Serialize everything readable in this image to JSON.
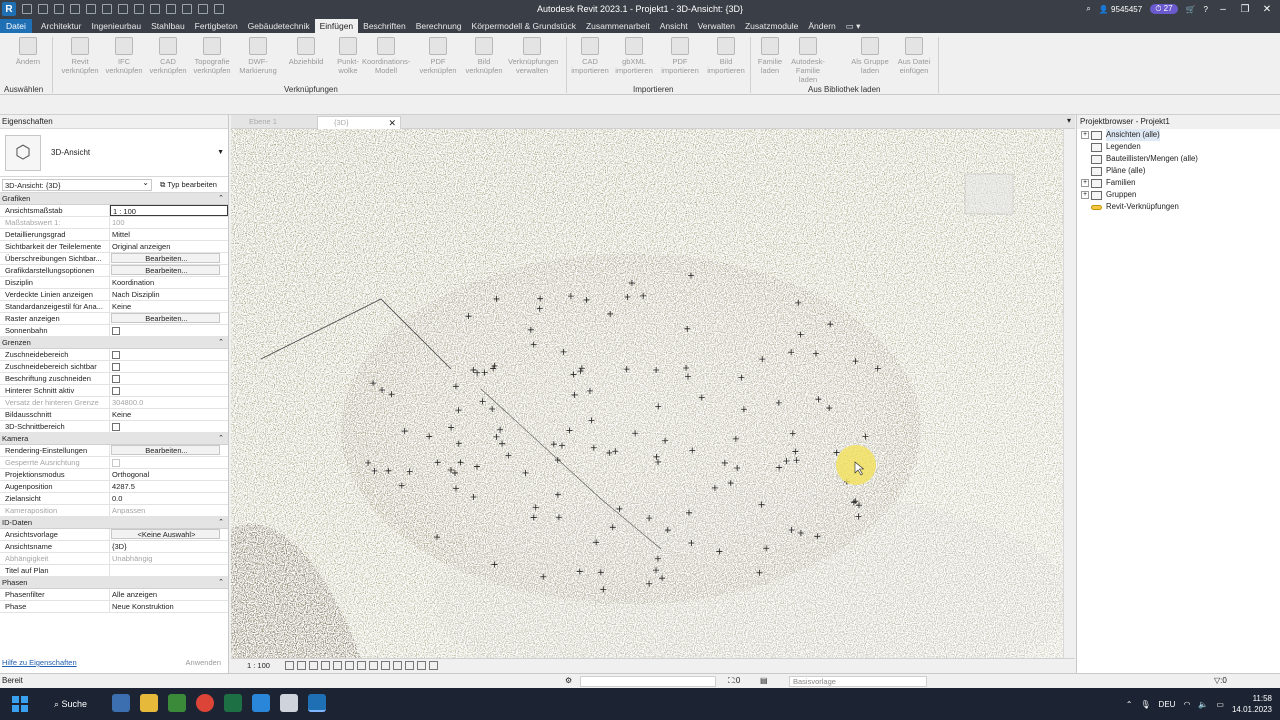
{
  "window": {
    "title": "Autodesk Revit 2023.1 - Projekt1 - 3D-Ansicht: {3D}",
    "user": "9545457",
    "notifications": "27"
  },
  "menu": {
    "tabs": [
      "Datei",
      "Architektur",
      "Ingenieurbau",
      "Stahlbau",
      "Fertigbeton",
      "Gebäudetechnik",
      "Einfügen",
      "Beschriften",
      "Berechnung",
      "Körpermodell & Grundstück",
      "Zusammenarbeit",
      "Ansicht",
      "Verwalten",
      "Zusatzmodule",
      "Ändern"
    ],
    "active": "Einfügen"
  },
  "ribbon": {
    "buttons": [
      {
        "l1": "Ändern",
        "l2": ""
      },
      {
        "l1": "Revit",
        "l2": "verknüpfen"
      },
      {
        "l1": "IFC",
        "l2": "verknüpfen"
      },
      {
        "l1": "CAD",
        "l2": "verknüpfen"
      },
      {
        "l1": "Topografie",
        "l2": "verknüpfen"
      },
      {
        "l1": "DWF-",
        "l2": "Markierung"
      },
      {
        "l1": "Abziehbild",
        "l2": ""
      },
      {
        "l1": "Punkt-",
        "l2": "wolke"
      },
      {
        "l1": "Koordinations-",
        "l2": "Modell"
      },
      {
        "l1": "PDF",
        "l2": "verknüpfen"
      },
      {
        "l1": "Bild",
        "l2": "verknüpfen"
      },
      {
        "l1": "Verknüpfungen",
        "l2": "verwalten"
      },
      {
        "l1": "CAD",
        "l2": "importieren"
      },
      {
        "l1": "gbXML",
        "l2": "importieren"
      },
      {
        "l1": "PDF",
        "l2": "importieren"
      },
      {
        "l1": "Bild",
        "l2": "importieren"
      },
      {
        "l1": "Familie",
        "l2": "laden"
      },
      {
        "l1": "Autodesk-Familie",
        "l2": "laden"
      },
      {
        "l1": "Als Gruppe",
        "l2": "laden"
      },
      {
        "l1": "Aus Datei",
        "l2": "einfügen"
      }
    ],
    "panels": [
      "Auswählen",
      "Verknüpfungen",
      "Importieren",
      "Aus Bibliothek laden"
    ]
  },
  "properties": {
    "title": "Eigenschaften",
    "type_name": "3D-Ansicht",
    "selector": "3D-Ansicht: {3D}",
    "edit_type": "Typ bearbeiten",
    "sections": [
      {
        "title": "Grafiken",
        "rows": [
          {
            "k": "Ansichtsmaßstab",
            "v": "1 : 100",
            "t": "input"
          },
          {
            "k": "Maßstabswert 1:",
            "v": "100",
            "t": "dim"
          },
          {
            "k": "Detaillierungsgrad",
            "v": "Mittel",
            "t": "text"
          },
          {
            "k": "Sichtbarkeit der Teilelemente",
            "v": "Original anzeigen",
            "t": "text"
          },
          {
            "k": "Überschreibungen Sichtbar...",
            "v": "Bearbeiten...",
            "t": "btn"
          },
          {
            "k": "Grafikdarstellungsoptionen",
            "v": "Bearbeiten...",
            "t": "btn"
          },
          {
            "k": "Disziplin",
            "v": "Koordination",
            "t": "text"
          },
          {
            "k": "Verdeckte Linien anzeigen",
            "v": "Nach Disziplin",
            "t": "text"
          },
          {
            "k": "Standardanzeigestil für Ana...",
            "v": "Keine",
            "t": "text"
          },
          {
            "k": "Raster anzeigen",
            "v": "Bearbeiten...",
            "t": "btn"
          },
          {
            "k": "Sonnenbahn",
            "v": "",
            "t": "chk"
          }
        ]
      },
      {
        "title": "Grenzen",
        "rows": [
          {
            "k": "Zuschneidebereich",
            "v": "",
            "t": "chk"
          },
          {
            "k": "Zuschneidebereich sichtbar",
            "v": "",
            "t": "chk"
          },
          {
            "k": "Beschriftung zuschneiden",
            "v": "",
            "t": "chk"
          },
          {
            "k": "Hinterer Schnitt aktiv",
            "v": "",
            "t": "chk"
          },
          {
            "k": "Versatz der hinteren Grenze",
            "v": "304800.0",
            "t": "dim"
          },
          {
            "k": "Bildausschnitt",
            "v": "Keine",
            "t": "text"
          },
          {
            "k": "3D-Schnittbereich",
            "v": "",
            "t": "chk"
          }
        ]
      },
      {
        "title": "Kamera",
        "rows": [
          {
            "k": "Rendering-Einstellungen",
            "v": "Bearbeiten...",
            "t": "btn"
          },
          {
            "k": "Gesperrte Ausrichtung",
            "v": "",
            "t": "dimchk"
          },
          {
            "k": "Projektionsmodus",
            "v": "Orthogonal",
            "t": "text"
          },
          {
            "k": "Augenposition",
            "v": "4287.5",
            "t": "text"
          },
          {
            "k": "Zielansicht",
            "v": "0.0",
            "t": "text"
          },
          {
            "k": "Kameraposition",
            "v": "Anpassen",
            "t": "dim"
          }
        ]
      },
      {
        "title": "ID-Daten",
        "rows": [
          {
            "k": "Ansichtsvorlage",
            "v": "<Keine Auswahl>",
            "t": "btn"
          },
          {
            "k": "Ansichtsname",
            "v": "{3D}",
            "t": "text"
          },
          {
            "k": "Abhängigkeit",
            "v": "Unabhängig",
            "t": "dim"
          },
          {
            "k": "Titel auf Plan",
            "v": "",
            "t": "text"
          }
        ]
      },
      {
        "title": "Phasen",
        "rows": [
          {
            "k": "Phasenfilter",
            "v": "Alle anzeigen",
            "t": "text"
          },
          {
            "k": "Phase",
            "v": "Neue Konstruktion",
            "t": "text"
          }
        ]
      }
    ],
    "help": "Hilfe zu Eigenschaften",
    "apply": "Anwenden"
  },
  "view": {
    "tabs": [
      {
        "label": "Ebene 1",
        "active": false
      },
      {
        "label": "{3D}",
        "active": true
      }
    ],
    "scale": "1 : 100"
  },
  "browser": {
    "title": "Projektbrowser - Projekt1",
    "items": [
      {
        "label": "Ansichten (alle)",
        "exp": "+",
        "sel": true,
        "link": false
      },
      {
        "label": "Legenden",
        "exp": "",
        "sel": false,
        "link": false
      },
      {
        "label": "Bauteillisten/Mengen (alle)",
        "exp": "",
        "sel": false,
        "link": false
      },
      {
        "label": "Pläne (alle)",
        "exp": "",
        "sel": false,
        "link": false
      },
      {
        "label": "Familien",
        "exp": "+",
        "sel": false,
        "link": false
      },
      {
        "label": "Gruppen",
        "exp": "+",
        "sel": false,
        "link": false
      },
      {
        "label": "Revit-Verknüpfungen",
        "exp": "",
        "sel": false,
        "link": true
      }
    ]
  },
  "status": {
    "ready": "Bereit",
    "selection_count": ":0",
    "template": "Basisvorlage",
    "filter": ":0"
  },
  "taskbar": {
    "search": "Suche",
    "lang": "DEU",
    "time": "11:58",
    "date": "14.01.2023"
  }
}
